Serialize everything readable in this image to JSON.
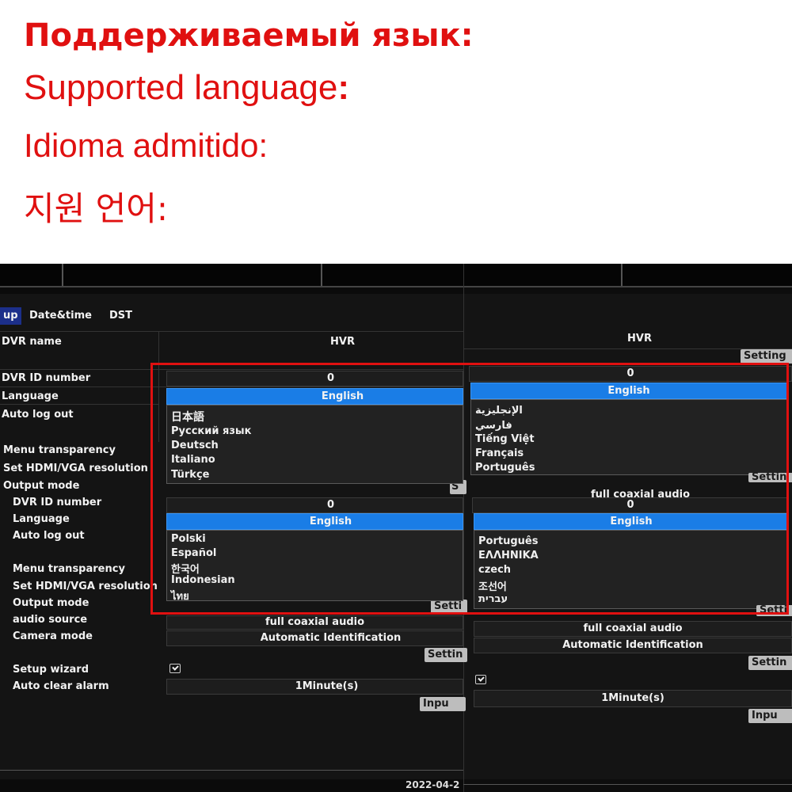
{
  "headings": {
    "ru": "Поддерживаемый язык:",
    "en": "Supported language",
    "en_colon": ":",
    "es": "Idioma admitido:",
    "ko": "지원 언어:"
  },
  "left_screen": {
    "tabs": [
      "up",
      "Date&time",
      "DST"
    ],
    "rows": {
      "dvr_name": "DVR name",
      "dvr_name_value": "HVR",
      "dvr_id": "DVR ID number",
      "dvr_id_value": "0",
      "language": "Language",
      "language_value": "English",
      "auto_logout": "Auto log out",
      "menu_transparency": "Menu transparency",
      "hdmi": "Set HDMI/VGA resolution",
      "output_mode": "Output mode"
    },
    "dropdown1": [
      "日本語",
      "Русский язык",
      "Deutsch",
      "Italiano",
      "Türkçe"
    ],
    "lower": {
      "dvr_id": "DVR ID number",
      "dvr_id_value": "0",
      "language": "Language",
      "language_value": "English",
      "auto_logout": "Auto log out",
      "menu_transparency": "Menu transparency",
      "hdmi": "Set HDMI/VGA resolution",
      "output_mode": "Output mode",
      "audio_source": "audio source",
      "audio_source_value": "full coaxial audio",
      "camera_mode": "Camera mode",
      "camera_mode_value": "Automatic Identification",
      "setup_wizard": "Setup wizard",
      "auto_clear": "Auto clear alarm",
      "auto_clear_value": "1Minute(s)"
    },
    "dropdown2": [
      "Polski",
      "Español",
      "한국어",
      "Indonesian",
      "ไทย"
    ],
    "btn_s": "S",
    "btn_setting": "Setti",
    "btn_setting2": "Settin",
    "btn_input": "Inpu",
    "date": "2022-04-2"
  },
  "right_screen": {
    "dvr_name_value": "HVR",
    "setting": "Setting",
    "dvr_id_value": "0",
    "language_value": "English",
    "dropdown1": [
      "الإنجليزية",
      "فارسي",
      "Tiếng Việt",
      "Français",
      "Português"
    ],
    "setting_cut": "Settin",
    "full_coax": "full coaxial audio",
    "dvr_id_value2": "0",
    "language_value2": "English",
    "dropdown2": [
      "Português",
      "ΕΛΛΗΝΙΚΑ",
      "czech",
      "조선어",
      "עברית"
    ],
    "setti": "Setti",
    "audio_value": "full coaxial audio",
    "camera_value": "Automatic Identification",
    "setting2": "Settin",
    "minutes": "1Minute(s)",
    "input": "Inpu"
  },
  "colors": {
    "accent": "#e01010",
    "selected": "#1a7de6",
    "tab_active": "#1c2f8a"
  }
}
